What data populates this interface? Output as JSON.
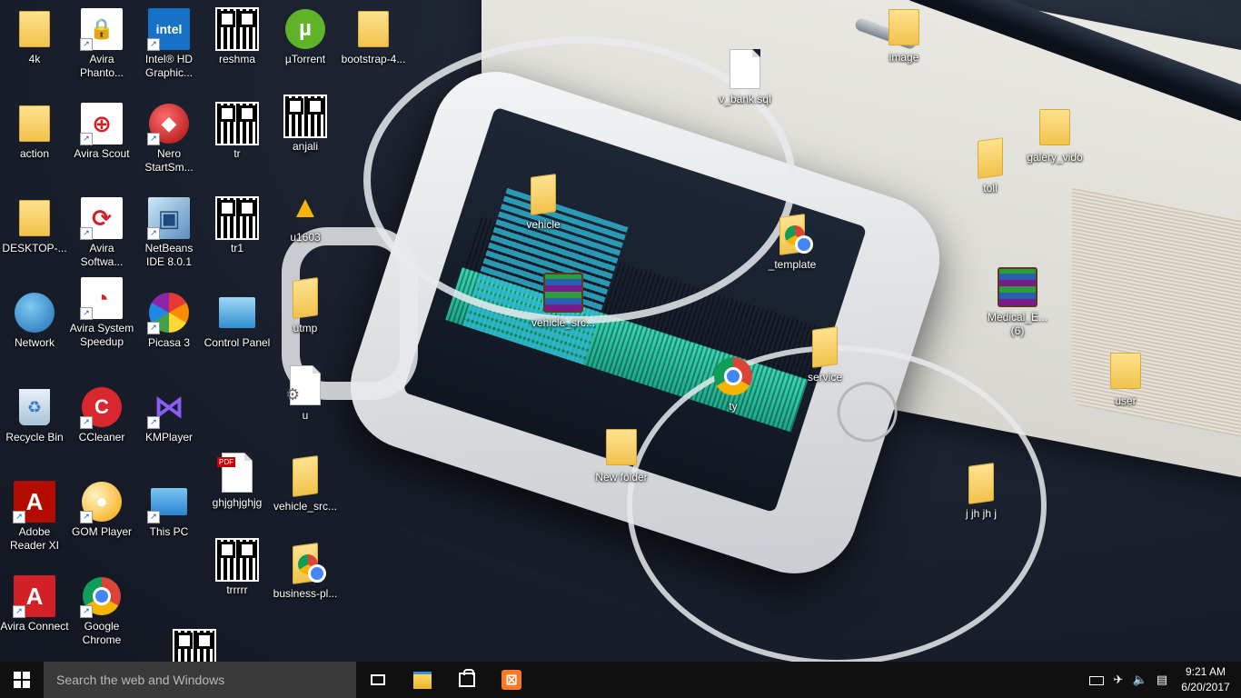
{
  "desktop": {
    "icons": {
      "4k": "4k",
      "avira_phantom": "Avira Phanto...",
      "intel_hd": "Intel® HD Graphic...",
      "reshma": "reshma",
      "utorrent": "µTorrent",
      "bootstrap": "bootstrap-4...",
      "action": "action",
      "avira_scout": "Avira Scout",
      "nero": "Nero StartSm...",
      "tr": "tr",
      "anjali": "anjali",
      "desktop_folder": "DESKTOP-...",
      "avira_software": "Avira Softwa...",
      "netbeans": "NetBeans IDE 8.0.1",
      "tr1": "tr1",
      "u1603": "u1603",
      "network": "Network",
      "avira_speedup": "Avira System Speedup",
      "picasa": "Picasa 3",
      "control_panel": "Control Panel",
      "utmp": "utmp",
      "recycle_bin": "Recycle Bin",
      "ccleaner": "CCleaner",
      "kmplayer": "KMPlayer",
      "u": "u",
      "adobe_reader": "Adobe Reader XI",
      "gom_player": "GOM Player",
      "this_pc": "This PC",
      "ghjghjghjg": "ghjghjghjg",
      "vehicle_src_folder": "vehicle_src...",
      "avira_connect": "Avira Connect",
      "google_chrome": "Google Chrome",
      "trrrrr": "trrrrr",
      "business_pl": "business-pl...",
      "v_bank_sql": "v_bank.sql",
      "vehicle": "vehicle",
      "vehicle_src_rar": "vehicle_src...",
      "template": "_template",
      "ty": "ty",
      "service": "service",
      "new_folder": "New folder",
      "image": "image",
      "galery_vido": "galery_vido",
      "toll": "toll",
      "medical": "Medical_E... (6)",
      "user": "user",
      "jjhjhj": "j jh jh j"
    }
  },
  "taskbar": {
    "search_placeholder": "Search the web and Windows",
    "time": "9:21 AM",
    "date": "6/20/2017"
  },
  "colors": {
    "taskbar_bg": "#101010",
    "search_bg": "#3a3a3a",
    "xampp_orange": "#fb7a24"
  }
}
